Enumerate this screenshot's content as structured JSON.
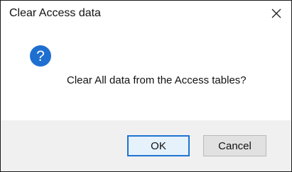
{
  "dialog": {
    "title": "Clear Access data",
    "close_icon": "close-icon",
    "message_icon": "question-icon",
    "message": "Clear All data from the Access tables?",
    "ok_label": "OK",
    "cancel_label": "Cancel"
  },
  "colors": {
    "accent": "#1e73d2",
    "icon_blue": "#1f6fd0",
    "footer_bg": "#f0f0f0"
  }
}
